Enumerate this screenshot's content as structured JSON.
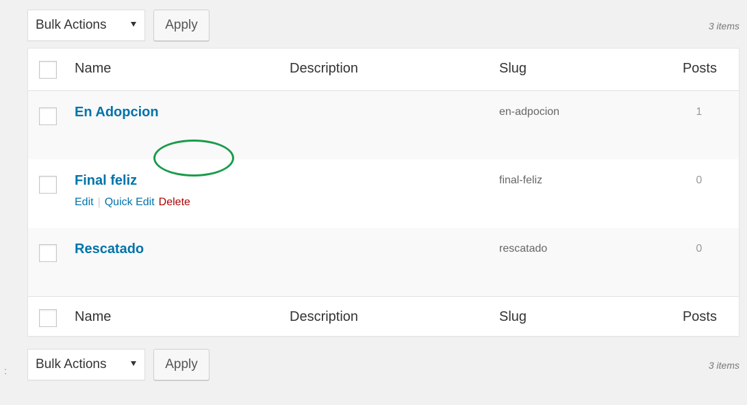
{
  "top_nav": {
    "bulk_actions_label": "Bulk Actions",
    "apply_label": "Apply",
    "item_count": "3 items"
  },
  "bottom_nav": {
    "bulk_actions_label": "Bulk Actions",
    "apply_label": "Apply",
    "item_count": "3 items"
  },
  "table": {
    "columns": {
      "name": "Name",
      "description": "Description",
      "slug": "Slug",
      "posts": "Posts"
    },
    "rows": [
      {
        "name": "En Adopcion",
        "description": "",
        "slug": "en-adpocion",
        "posts": "1"
      },
      {
        "name": "Final feliz",
        "description": "",
        "slug": "final-feliz",
        "posts": "0"
      },
      {
        "name": "Rescatado",
        "description": "",
        "slug": "rescatado",
        "posts": "0"
      }
    ],
    "row_actions": {
      "edit": "Edit",
      "separator": "|",
      "quick_edit": "Quick Edit",
      "delete": "Delete"
    }
  },
  "left_mark": ":",
  "colors": {
    "link": "#0073aa",
    "delete": "#aa0000",
    "highlight": "#1a9b4a",
    "background": "#f1f1f1"
  },
  "icons": {
    "dropdown": "caret-down-icon",
    "checkbox": "checkbox-icon"
  }
}
